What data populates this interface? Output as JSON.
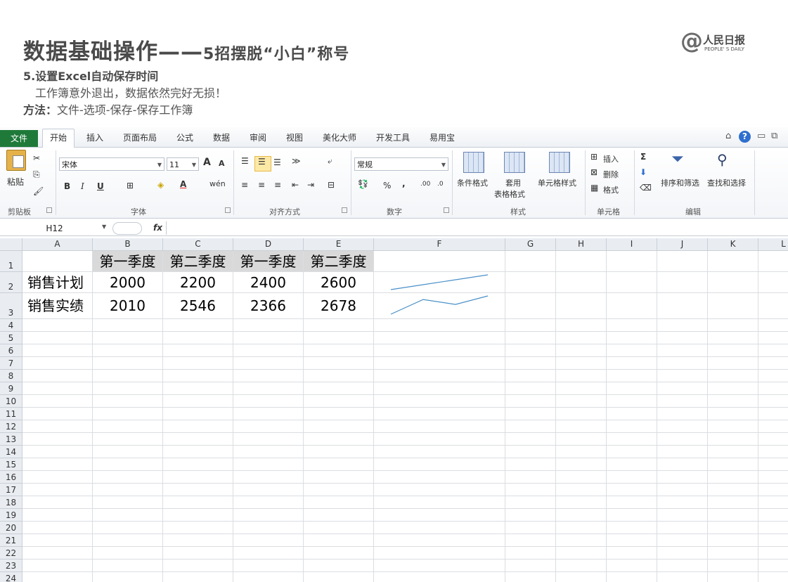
{
  "slide": {
    "title_main": "数据基础操作——",
    "title_sub": "5招摆脱“小白”称号",
    "logo_at": "@",
    "logo_cn": "人民日报",
    "logo_en": "PEOPLE' S DAILY",
    "step": "5.设置Excel自动保存时间",
    "description": "工作簿意外退出，数据依然完好无损！",
    "method_label": "方法：",
    "method_text": "文件-选项-保存-保存工作簿"
  },
  "ribbon": {
    "file_tab": "文件",
    "tabs": [
      "开始",
      "插入",
      "页面布局",
      "公式",
      "数据",
      "审阅",
      "视图",
      "美化大师",
      "开发工具",
      "易用宝"
    ],
    "window_controls": {
      "collapse": "⌂",
      "help": "?",
      "minimize": "▭",
      "restore": "⧉"
    },
    "groups": [
      "剪贴板",
      "字体",
      "对齐方式",
      "数字",
      "样式",
      "单元格",
      "编辑"
    ],
    "clipboard": {
      "paste": "粘贴"
    },
    "font": {
      "name": "宋体",
      "size": "11",
      "grow": "A",
      "shrink": "A",
      "bold": "B",
      "italic": "I",
      "underline": "U",
      "phonetic": "wén"
    },
    "number": {
      "format": "常规",
      "percent": "%",
      "comma": ",",
      "inc_decimal": ".00",
      "dec_decimal": ".0"
    },
    "styles": {
      "conditional": "条件格式",
      "table_line1": "套用",
      "table_line2": "表格格式",
      "cell_styles": "单元格样式"
    },
    "cells": {
      "insert": "插入",
      "delete": "删除",
      "format": "格式"
    },
    "editing": {
      "sigma": "Σ",
      "sort_filter": "排序和筛选",
      "find_select": "查找和选择"
    }
  },
  "formula_bar": {
    "name_box": "H12",
    "fx": "fx",
    "value": ""
  },
  "sheet": {
    "columns": [
      "A",
      "B",
      "C",
      "D",
      "E",
      "F",
      "G",
      "H",
      "I",
      "J",
      "K",
      "L"
    ],
    "rows": [
      "1",
      "2",
      "3",
      "4",
      "5",
      "6",
      "7",
      "8",
      "9",
      "10",
      "11",
      "12",
      "13",
      "14",
      "15",
      "16",
      "17",
      "18",
      "19",
      "20",
      "21",
      "22",
      "23",
      "24"
    ],
    "header_row": [
      "第一季度",
      "第二季度",
      "第一季度",
      "第二季度"
    ],
    "row2_label": "销售计划",
    "row3_label": "销售实绩",
    "plan": [
      "2000",
      "2200",
      "2400",
      "2600"
    ],
    "actual": [
      "2010",
      "2546",
      "2366",
      "2678"
    ]
  },
  "chart_data": {
    "type": "line",
    "categories": [
      "第一季度",
      "第二季度",
      "第一季度",
      "第二季度"
    ],
    "series": [
      {
        "name": "销售计划",
        "values": [
          2000,
          2200,
          2400,
          2600
        ]
      },
      {
        "name": "销售实绩",
        "values": [
          2010,
          2546,
          2366,
          2678
        ]
      }
    ],
    "sparkline_color": "#4a90c8"
  }
}
